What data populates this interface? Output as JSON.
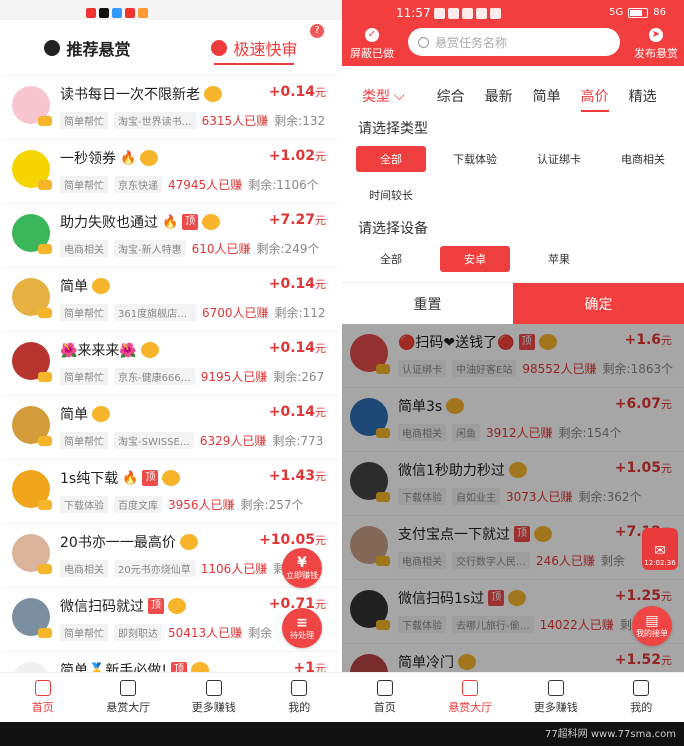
{
  "left": {
    "tabs": [
      {
        "label": "推荐悬赏"
      },
      {
        "label": "极速快审"
      }
    ],
    "help": "?",
    "tasks": [
      {
        "title": "读书每日一次不限新老",
        "cat": "简单帮忙",
        "shop": "淘宝-世界读书…",
        "earned": "6315人已赚",
        "remain": "剩余:132",
        "reward": "+0.14",
        "unit": "元",
        "ding": false,
        "fire": false
      },
      {
        "title": "一秒领券",
        "cat": "简单帮忙",
        "shop": "京东快递",
        "earned": "47945人已赚",
        "remain": "剩余:1106个",
        "reward": "+1.02",
        "unit": "元",
        "ding": false,
        "fire": true
      },
      {
        "title": "助力失败也通过",
        "cat": "电商相关",
        "shop": "淘宝-新人特惠",
        "earned": "610人已赚",
        "remain": "剩余:249个",
        "reward": "+7.27",
        "unit": "元",
        "ding": true,
        "fire": true
      },
      {
        "title": "简单",
        "cat": "简单帮忙",
        "shop": "361度旗舰店0…",
        "earned": "6700人已赚",
        "remain": "剩余:112",
        "reward": "+0.14",
        "unit": "元",
        "ding": false,
        "fire": false
      },
      {
        "title": "🌺来来来🌺",
        "cat": "简单帮忙",
        "shop": "京东-健康666…",
        "earned": "9195人已赚",
        "remain": "剩余:267",
        "reward": "+0.14",
        "unit": "元",
        "ding": false,
        "fire": false
      },
      {
        "title": "简单",
        "cat": "简单帮忙",
        "shop": "淘宝-SWISSE…",
        "earned": "6329人已赚",
        "remain": "剩余:773",
        "reward": "+0.14",
        "unit": "元",
        "ding": false,
        "fire": false
      },
      {
        "title": "1s纯下载",
        "cat": "下载体验",
        "shop": "百度文库",
        "earned": "3956人已赚",
        "remain": "剩余:257个",
        "reward": "+1.43",
        "unit": "元",
        "ding": true,
        "fire": true
      },
      {
        "title": "20书亦一一最高价",
        "cat": "电商相关",
        "shop": "20元书亦烧仙草",
        "earned": "1106人已赚",
        "remain": "剩余",
        "reward": "+10.05",
        "unit": "元",
        "ding": false,
        "fire": false
      },
      {
        "title": "微信扫码就过",
        "cat": "简单帮忙",
        "shop": "即刻职达",
        "earned": "50413人已赚",
        "remain": "剩余",
        "reward": "+0.71",
        "unit": "元",
        "ding": true,
        "fire": false
      },
      {
        "title": "简单🥇新手必做!",
        "cat": "",
        "shop": "",
        "earned": "",
        "remain": "",
        "reward": "+1",
        "unit": "元",
        "ding": true,
        "fire": false
      }
    ],
    "float_earn": {
      "symbol": "¥",
      "label": "立即赚钱"
    },
    "float_pending": {
      "symbol": "≡",
      "label": "待处理"
    }
  },
  "nav": [
    {
      "label": "首页",
      "icon": "home-icon"
    },
    {
      "label": "悬赏大厅",
      "icon": "yuan-icon"
    },
    {
      "label": "更多赚钱",
      "icon": "gamepad-icon"
    },
    {
      "label": "我的",
      "icon": "user-icon"
    }
  ],
  "right": {
    "status": {
      "time": "11:57",
      "signal": "5G",
      "battery": "86"
    },
    "shield": "屏蔽已做",
    "search_placeholder": "悬赏任务名称",
    "publish": "发布悬赏",
    "filter_tabs": {
      "type": "类型",
      "items": [
        "综合",
        "最新",
        "简单",
        "高价",
        "精选"
      ]
    },
    "type_label": "请选择类型",
    "types": [
      "全部",
      "下载体验",
      "认证绑卡",
      "电商相关",
      "时间较长"
    ],
    "device_label": "请选择设备",
    "devices": [
      "全部",
      "安卓",
      "苹果"
    ],
    "reset": "重置",
    "confirm": "确定",
    "tasks": [
      {
        "title": "🔴扫码❤送钱了🔴",
        "cat": "认证绑卡",
        "shop": "中油好客E站",
        "earned": "98552人已赚",
        "remain": "剩余:1863个",
        "reward": "+1.6",
        "ding": true
      },
      {
        "title": "简单3s",
        "cat": "电商相关",
        "shop": "闲鱼",
        "earned": "3912人已赚",
        "remain": "剩余:154个",
        "reward": "+6.07",
        "ding": false
      },
      {
        "title": "微信1秒助力秒过",
        "cat": "下载体验",
        "shop": "自如业主",
        "earned": "3073人已赚",
        "remain": "剩余:362个",
        "reward": "+1.05",
        "ding": false
      },
      {
        "title": "支付宝点一下就过",
        "cat": "电商相关",
        "shop": "交行数字人民…",
        "earned": "246人已赚",
        "remain": "剩余",
        "reward": "+7.12",
        "ding": true
      },
      {
        "title": "微信扫码1s过",
        "cat": "下载体验",
        "shop": "去哪儿旅行-偷…",
        "earned": "14022人已赚",
        "remain": "剩余:804",
        "reward": "+1.25",
        "ding": true
      },
      {
        "title": "简单冷门",
        "cat": "",
        "shop": "",
        "earned": "",
        "remain": "",
        "reward": "+1.52",
        "ding": false
      }
    ],
    "timer": "12:02:36",
    "my_orders": "我的接单"
  },
  "watermark": "77超科网 www.77sma.com",
  "colors": {
    "accent": "#f03b3b",
    "badge": "#f8b52c",
    "header": "#f23e3e"
  }
}
